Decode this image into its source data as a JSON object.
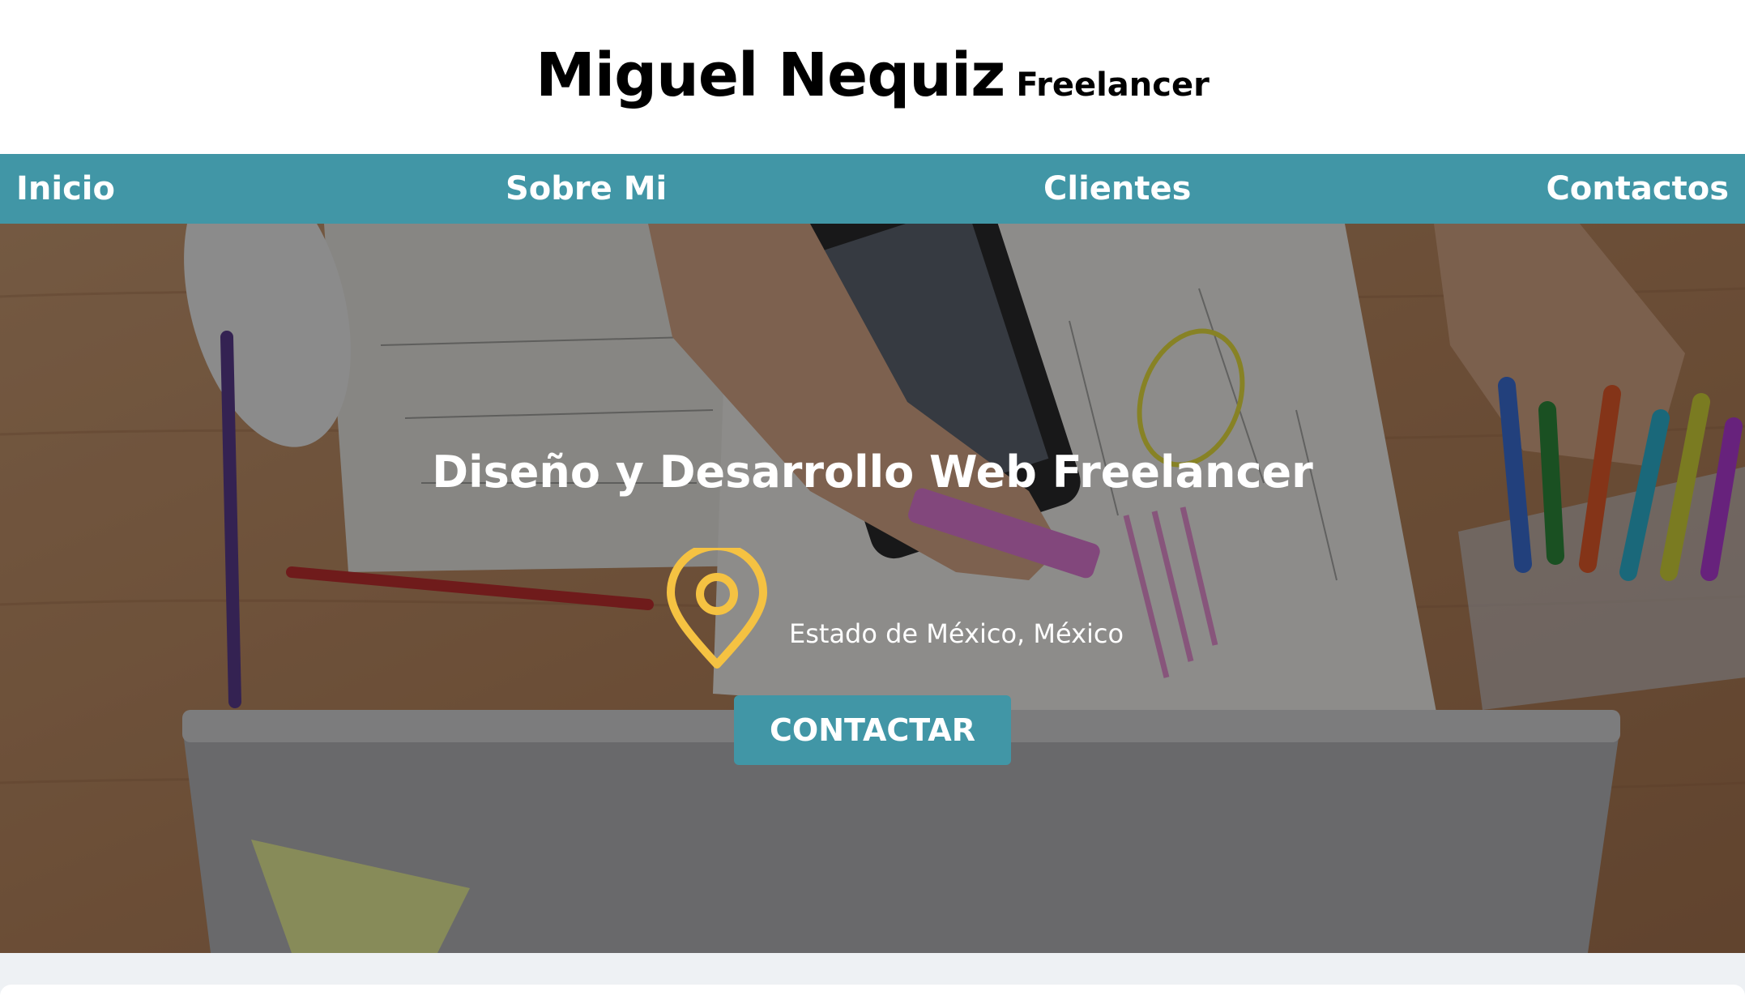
{
  "header": {
    "name": "Miguel Nequiz",
    "role": "Freelancer"
  },
  "nav": {
    "items": [
      {
        "label": "Inicio"
      },
      {
        "label": "Sobre Mi"
      },
      {
        "label": "Clientes"
      },
      {
        "label": "Contactos"
      }
    ]
  },
  "hero": {
    "title": "Diseño y Desarrollo Web Freelancer",
    "location_icon": "map-pin-icon",
    "location": "Estado de México, México",
    "cta_label": "CONTACTAR"
  },
  "colors": {
    "accent": "#4196a6",
    "pin": "#f5c242",
    "text_light": "#ffffff"
  }
}
